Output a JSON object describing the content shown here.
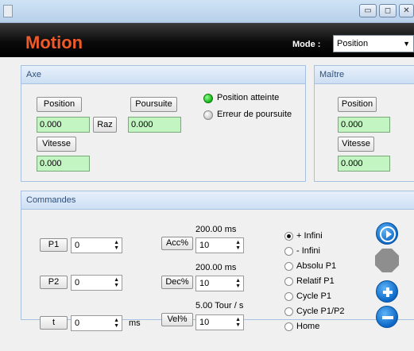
{
  "window": {
    "buttons": {
      "minimize": "▭",
      "maximize": "◻",
      "close": "✕"
    }
  },
  "header": {
    "title": "Motion",
    "mode_label": "Mode :",
    "mode_value": "Position",
    "colors": {
      "title": "#ee5a2a",
      "header_bg": "#000000"
    }
  },
  "axe": {
    "title": "Axe",
    "position_button": "Position",
    "position_value": "0.000",
    "raz_button": "Raz",
    "poursuite_button": "Poursuite",
    "poursuite_value": "0.000",
    "vitesse_button": "Vitesse",
    "vitesse_value": "0.000",
    "status": [
      {
        "label": "Position atteinte",
        "state": "on"
      },
      {
        "label": "Erreur de poursuite",
        "state": "off"
      }
    ]
  },
  "maitre": {
    "title": "Maître",
    "position_button": "Position",
    "position_value": "0.000",
    "vitesse_button": "Vitesse",
    "vitesse_value": "0.000"
  },
  "commandes": {
    "title": "Commandes",
    "p1_label": "P1",
    "p1_value": "0",
    "p2_label": "P2",
    "p2_value": "0",
    "t_label": "t",
    "t_value": "0",
    "t_unit": "ms",
    "acc_label": "Acc%",
    "acc_value": "10",
    "acc_info": "200.00 ms",
    "dec_label": "Dec%",
    "dec_value": "10",
    "dec_info": "200.00 ms",
    "vel_label": "Vel%",
    "vel_value": "10",
    "vel_info": "5.00 Tour / s",
    "modes": [
      {
        "label": "+ Infini",
        "selected": true
      },
      {
        "label": "- Infini",
        "selected": false
      },
      {
        "label": "Absolu P1",
        "selected": false
      },
      {
        "label": "Relatif P1",
        "selected": false
      },
      {
        "label": "Cycle P1",
        "selected": false
      },
      {
        "label": "Cycle P1/P2",
        "selected": false
      },
      {
        "label": "Home",
        "selected": false
      }
    ],
    "actions": {
      "play_icon": "play-icon",
      "stop_icon": "stop-icon",
      "plus_icon": "plus-icon",
      "minus_icon": "minus-icon"
    }
  }
}
